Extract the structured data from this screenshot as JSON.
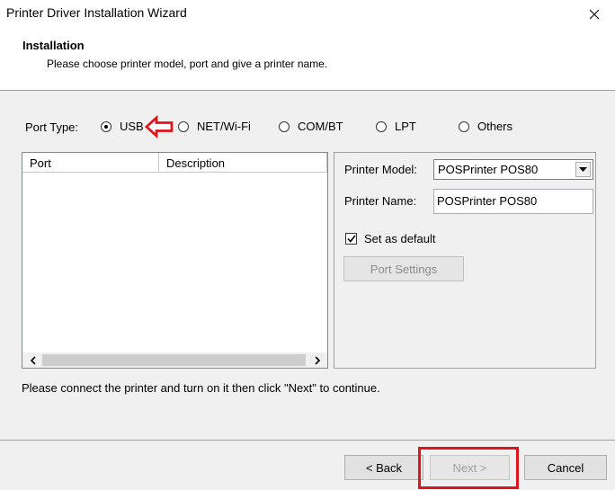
{
  "window": {
    "title": "Printer Driver Installation Wizard"
  },
  "header": {
    "title": "Installation",
    "subtitle": "Please choose printer model, port and give a printer name."
  },
  "port_type": {
    "label": "Port Type:",
    "options": [
      {
        "label": "USB",
        "selected": true
      },
      {
        "label": "NET/Wi-Fi",
        "selected": false
      },
      {
        "label": "COM/BT",
        "selected": false
      },
      {
        "label": "LPT",
        "selected": false
      },
      {
        "label": "Others",
        "selected": false
      }
    ]
  },
  "port_list": {
    "columns": [
      "Port",
      "Description"
    ],
    "rows": []
  },
  "printer_model": {
    "label": "Printer Model:",
    "value": "POSPrinter POS80"
  },
  "printer_name": {
    "label": "Printer Name:",
    "value": "POSPrinter POS80"
  },
  "set_default": {
    "label": "Set as default",
    "checked": true
  },
  "port_settings_button": {
    "label": "Port Settings",
    "enabled": false
  },
  "status_text": "Please connect the printer and turn on it then click \"Next\" to continue.",
  "footer": {
    "back_label": "< Back",
    "next_label": "Next >",
    "cancel_label": "Cancel",
    "next_enabled": false
  },
  "annotation_color": "#e0141c",
  "icons": {
    "close": "close-icon",
    "dropdown": "chevron-down-icon",
    "scroll_left": "chevron-left-icon",
    "scroll_right": "chevron-right-icon",
    "checkmark": "check-icon",
    "annotation_arrow": "arrow-left-icon"
  }
}
